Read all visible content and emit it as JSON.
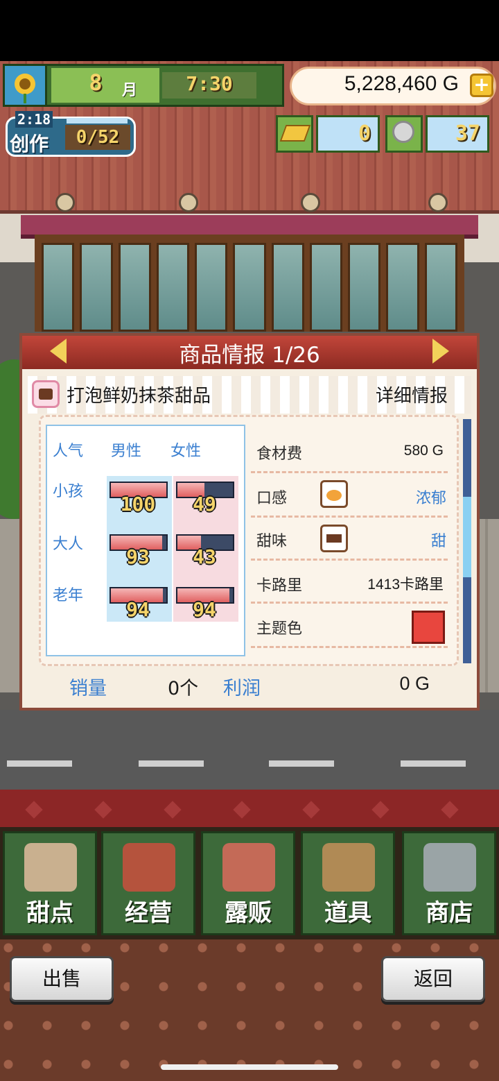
{
  "hud": {
    "month": "8",
    "month_unit": "月",
    "time": "7:30",
    "money": "5,228,460 G",
    "create_timer": "2:18",
    "create_label": "创作",
    "create_count": "0/52",
    "gold_count": "0",
    "medal_count": "37"
  },
  "panel": {
    "title": "商品情报 1/26",
    "item_name": "打泡鲜奶抹茶甜品",
    "detail_label": "详细情报",
    "popularity": {
      "header": "人气",
      "male": "男性",
      "female": "女性",
      "rows": [
        {
          "label": "小孩",
          "male": 100,
          "female": 49
        },
        {
          "label": "大人",
          "male": 93,
          "female": 43
        },
        {
          "label": "老年",
          "male": 94,
          "female": 94
        }
      ]
    },
    "info": {
      "cost_label": "食材费",
      "cost_value": "580 G",
      "texture_label": "口感",
      "texture_value": "浓郁",
      "sweet_label": "甜味",
      "sweet_value": "甜",
      "calorie_label": "卡路里",
      "calorie_value": "1413卡路里",
      "theme_label": "主题色",
      "theme_color": "#e8463e"
    },
    "sales_label": "销量",
    "sales_value": "0个",
    "profit_label": "利润",
    "profit_value": "0 G"
  },
  "nav": {
    "items": [
      {
        "label": "甜点",
        "icon": "dessert-plate-icon"
      },
      {
        "label": "经营",
        "icon": "shop-building-icon"
      },
      {
        "label": "露贩",
        "icon": "food-truck-icon"
      },
      {
        "label": "道具",
        "icon": "gear-sack-icon"
      },
      {
        "label": "商店",
        "icon": "shopping-cart-icon"
      }
    ]
  },
  "footer": {
    "sell_label": "出售",
    "back_label": "返回"
  }
}
